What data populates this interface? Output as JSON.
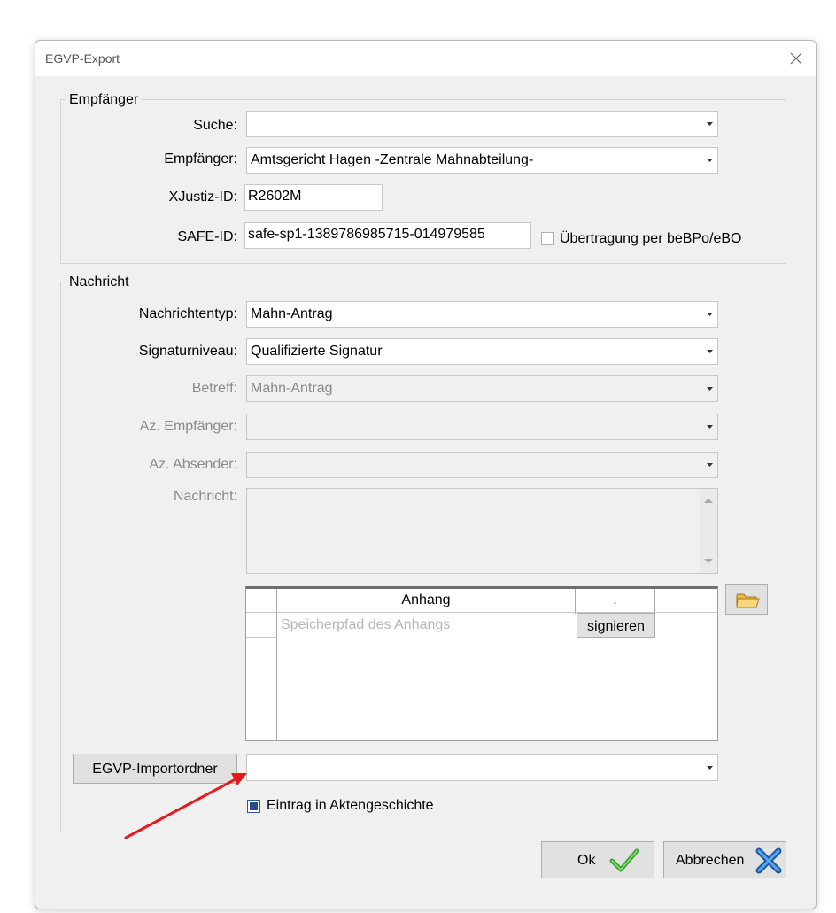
{
  "window": {
    "title": "EGVP-Export"
  },
  "recipient_group": {
    "legend": "Empfänger",
    "search": {
      "label": "Suche:",
      "value": ""
    },
    "recipient": {
      "label": "Empfänger:",
      "value": "Amtsgericht Hagen -Zentrale Mahnabteilung-"
    },
    "xjustiz": {
      "label": "XJustiz-ID:",
      "value": "R2602M"
    },
    "safe": {
      "label": "SAFE-ID:",
      "value": "safe-sp1-1389786985715-014979585"
    },
    "bebpo_checkbox": {
      "label": "Übertragung per beBPo/eBO",
      "checked": false
    }
  },
  "message_group": {
    "legend": "Nachricht",
    "message_type": {
      "label": "Nachrichtentyp:",
      "value": "Mahn-Antrag"
    },
    "signature_level": {
      "label": "Signaturniveau:",
      "value": "Qualifizierte Signatur"
    },
    "subject": {
      "label": "Betreff:",
      "value": "Mahn-Antrag"
    },
    "az_recipient": {
      "label": "Az. Empfänger:",
      "value": ""
    },
    "az_sender": {
      "label": "Az. Absender:",
      "value": ""
    },
    "message": {
      "label": "Nachricht:",
      "value": ""
    },
    "attachments": {
      "col_header": "Anhang",
      "col_header2": ".",
      "rows": [
        {
          "path_placeholder": "Speicherpfad des Anhangs",
          "sign_label": "signieren"
        }
      ]
    },
    "import_folder_button": "EGVP-Importordner",
    "import_folder_value": "",
    "history_checkbox": {
      "label": "Eintrag in Aktengeschichte",
      "checked": true
    }
  },
  "footer": {
    "ok_label": "Ok",
    "cancel_label": "Abbrechen"
  },
  "colors": {
    "arrow_annotation": "#e8191d",
    "ok_check": "#3aa63a",
    "cancel_x": "#2a78c8"
  },
  "icons": [
    "close-icon",
    "chevron-down-icon",
    "folder-icon",
    "checkmark-icon",
    "cross-icon"
  ]
}
